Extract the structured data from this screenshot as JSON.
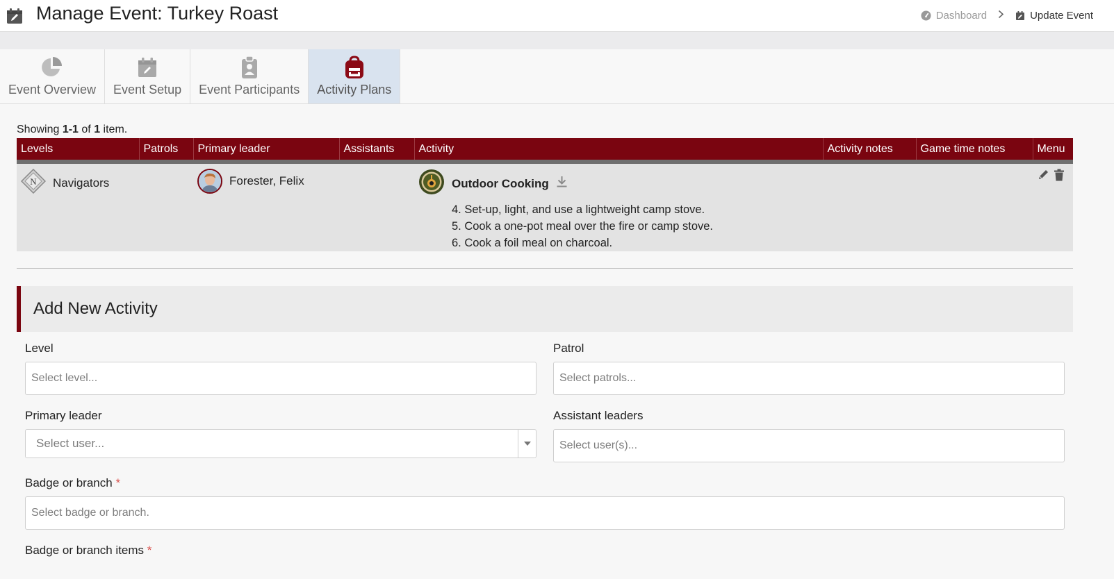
{
  "header": {
    "title": "Manage Event: Turkey Roast",
    "breadcrumbs": [
      {
        "label": "Dashboard",
        "icon": "gauge-icon"
      },
      {
        "label": "Update Event",
        "icon": "calendar-edit-icon"
      }
    ]
  },
  "tabs": [
    {
      "label": "Event Overview",
      "icon": "pie-chart-icon",
      "active": false
    },
    {
      "label": "Event Setup",
      "icon": "calendar-edit-icon",
      "active": false
    },
    {
      "label": "Event Participants",
      "icon": "id-badge-icon",
      "active": false
    },
    {
      "label": "Activity Plans",
      "icon": "backpack-icon",
      "active": true
    }
  ],
  "table": {
    "summary_prefix": "Showing ",
    "summary_range": "1-1",
    "summary_mid": " of ",
    "summary_total": "1",
    "summary_suffix": " item.",
    "columns": [
      "Levels",
      "Patrols",
      "Primary leader",
      "Assistants",
      "Activity",
      "Activity notes",
      "Game time notes",
      "Menu"
    ],
    "rows": [
      {
        "level": "Navigators",
        "patrols": "",
        "primary_leader": "Forester, Felix",
        "assistants": "",
        "activity_title": "Outdoor Cooking",
        "activity_items": [
          "4. Set-up, light, and use a lightweight camp stove.",
          "5. Cook a one-pot meal over the fire or camp stove.",
          "6. Cook a foil meal on charcoal."
        ],
        "activity_notes": "",
        "game_time_notes": ""
      }
    ]
  },
  "form": {
    "title": "Add New Activity",
    "level": {
      "label": "Level",
      "placeholder": "Select level..."
    },
    "patrol": {
      "label": "Patrol",
      "placeholder": "Select patrols..."
    },
    "primary_leader": {
      "label": "Primary leader",
      "placeholder": "Select user..."
    },
    "assistant_leaders": {
      "label": "Assistant leaders",
      "placeholder": "Select user(s)..."
    },
    "badge": {
      "label": "Badge or branch",
      "required_mark": "*",
      "placeholder": "Select badge or branch."
    },
    "badge_items": {
      "label": "Badge or branch items",
      "required_mark": "*"
    }
  },
  "colors": {
    "brand": "#7a0510",
    "active_tab": "#d9e3ef",
    "row_bg": "#e3e3e3"
  }
}
